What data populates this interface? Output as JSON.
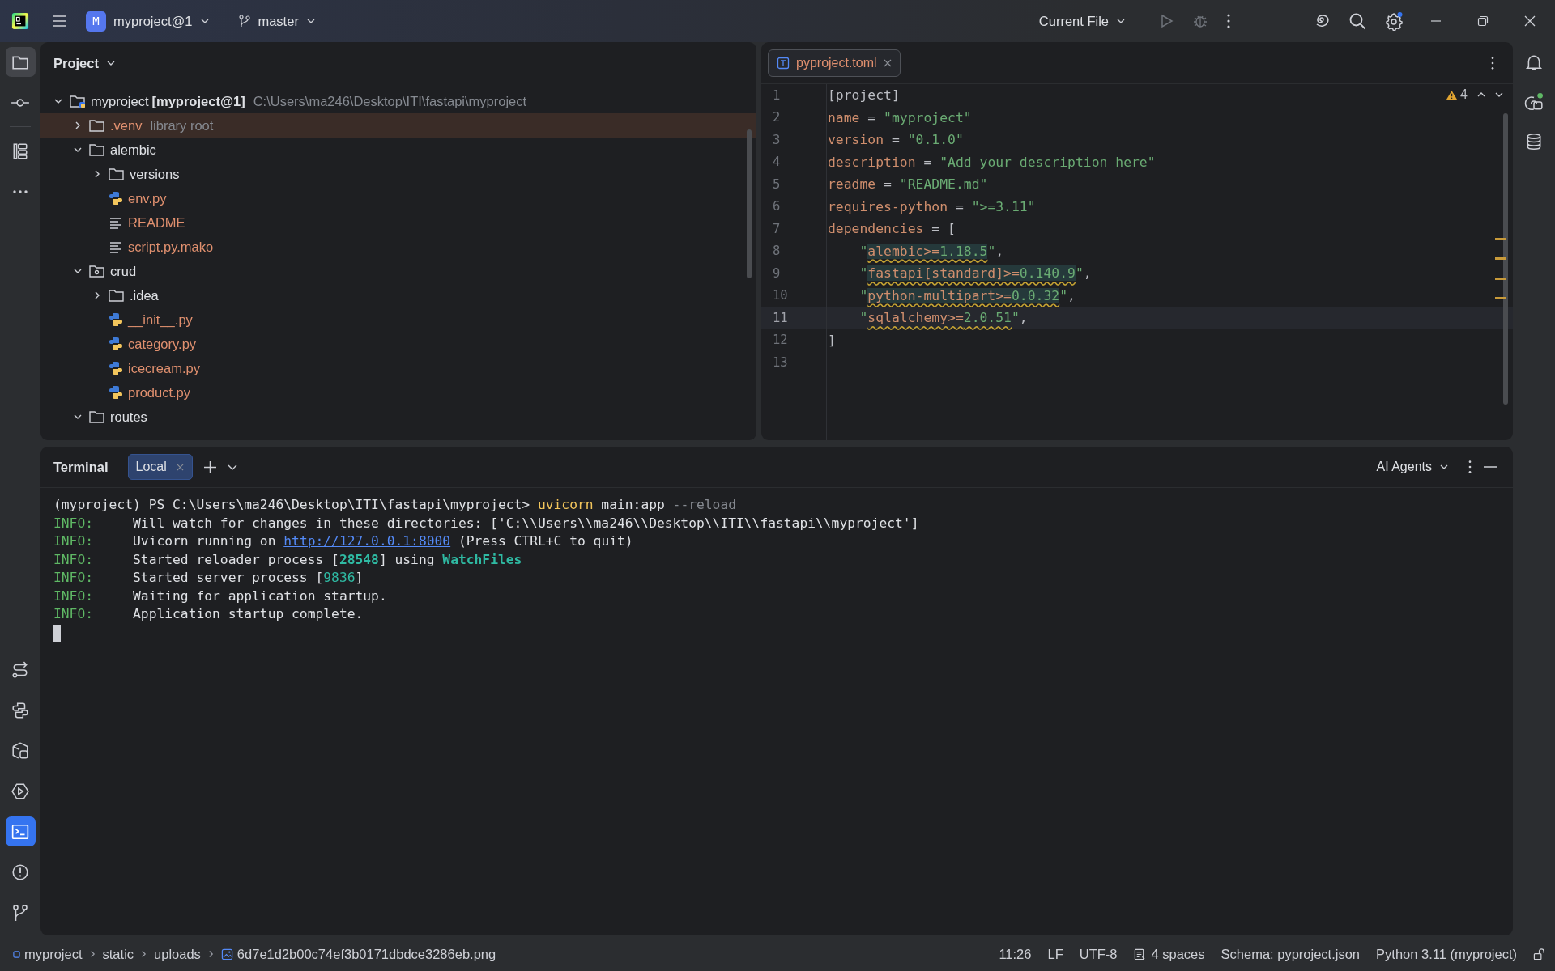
{
  "top_bar": {
    "project": {
      "badge": "M",
      "name": "myproject@1"
    },
    "branch": "master",
    "run_config": "Current File"
  },
  "left_toolbar": {
    "top": [
      {
        "selected": true
      },
      {
        "selected": false
      },
      {
        "selected": false
      },
      {
        "selected": false
      }
    ],
    "bottom": [
      {
        "selected": false
      },
      {
        "selected": false
      },
      {
        "selected": false
      },
      {
        "selected": false
      },
      {
        "selected": true
      },
      {
        "selected": false
      },
      {
        "selected": false
      }
    ]
  },
  "project_panel": {
    "title": "Project",
    "tree": [
      {
        "name": "myproject",
        "module": "[myproject@1]",
        "path": "C:\\Users\\ma246\\Desktop\\ITI\\fastapi\\myproject",
        "kind": "root",
        "expanded": true,
        "selected": false,
        "untracked": false,
        "children": [
          {
            "name": ".venv",
            "note": "library root",
            "kind": "folder",
            "expanded": false,
            "selected": true,
            "untracked": true
          },
          {
            "name": "alembic",
            "kind": "folder",
            "expanded": true,
            "selected": false,
            "untracked": false,
            "children": [
              {
                "name": "versions",
                "kind": "folder",
                "expanded": false,
                "selected": false,
                "untracked": false
              },
              {
                "name": "env.py",
                "kind": "python",
                "selected": false,
                "untracked": true
              },
              {
                "name": "README",
                "kind": "text",
                "selected": false,
                "untracked": true
              },
              {
                "name": "script.py.mako",
                "kind": "text",
                "selected": false,
                "untracked": true
              }
            ]
          },
          {
            "name": "crud",
            "kind": "package",
            "expanded": true,
            "selected": false,
            "untracked": false,
            "children": [
              {
                "name": ".idea",
                "kind": "folder",
                "expanded": false,
                "selected": false,
                "untracked": false
              },
              {
                "name": "__init__.py",
                "kind": "python",
                "selected": false,
                "untracked": true
              },
              {
                "name": "category.py",
                "kind": "python",
                "selected": false,
                "untracked": true
              },
              {
                "name": "icecream.py",
                "kind": "python",
                "selected": false,
                "untracked": true
              },
              {
                "name": "product.py",
                "kind": "python",
                "selected": false,
                "untracked": true
              }
            ]
          },
          {
            "name": "routes",
            "kind": "folder",
            "expanded": true,
            "selected": false,
            "untracked": false
          }
        ]
      }
    ]
  },
  "editor": {
    "tabs": [
      {
        "label": "pyproject.toml",
        "selected": true
      }
    ],
    "warnings": "4",
    "lines": [
      {
        "number": "1",
        "current": false,
        "segments": [
          {
            "text": "[project]",
            "kind": "punct"
          }
        ]
      },
      {
        "number": "2",
        "current": false,
        "segments": [
          {
            "text": "name",
            "kind": "key"
          },
          {
            "text": " = ",
            "kind": "punct"
          },
          {
            "text": "\"myproject\"",
            "kind": "str"
          }
        ]
      },
      {
        "number": "3",
        "current": false,
        "segments": [
          {
            "text": "version",
            "kind": "key"
          },
          {
            "text": " = ",
            "kind": "punct"
          },
          {
            "text": "\"0.1.0\"",
            "kind": "str"
          }
        ]
      },
      {
        "number": "4",
        "current": false,
        "segments": [
          {
            "text": "description",
            "kind": "key"
          },
          {
            "text": " = ",
            "kind": "punct"
          },
          {
            "text": "\"Add your description here\"",
            "kind": "str"
          }
        ]
      },
      {
        "number": "5",
        "current": false,
        "segments": [
          {
            "text": "readme",
            "kind": "key"
          },
          {
            "text": " = ",
            "kind": "punct"
          },
          {
            "text": "\"README.md\"",
            "kind": "str"
          }
        ]
      },
      {
        "number": "6",
        "current": false,
        "segments": [
          {
            "text": "requires-python",
            "kind": "key"
          },
          {
            "text": " = ",
            "kind": "punct"
          },
          {
            "text": "\">=3.11\"",
            "kind": "str"
          }
        ]
      },
      {
        "number": "7",
        "current": false,
        "segments": [
          {
            "text": "dependencies",
            "kind": "key"
          },
          {
            "text": " = [",
            "kind": "punct"
          }
        ]
      },
      {
        "number": "8",
        "current": false,
        "highlighted": true,
        "segments": [
          {
            "text": "    \"",
            "kind": "str"
          },
          {
            "text": "alembic>=",
            "kind": "package"
          },
          {
            "text": "1.18.5",
            "kind": "version"
          },
          {
            "text": "\"",
            "kind": "str"
          },
          {
            "text": ",",
            "kind": "punct"
          }
        ]
      },
      {
        "number": "9",
        "current": false,
        "highlighted": true,
        "segments": [
          {
            "text": "    \"",
            "kind": "str"
          },
          {
            "text": "fastapi[standard]>=",
            "kind": "package"
          },
          {
            "text": "0.140.9",
            "kind": "version"
          },
          {
            "text": "\"",
            "kind": "str"
          },
          {
            "text": ",",
            "kind": "punct"
          }
        ]
      },
      {
        "number": "10",
        "current": false,
        "highlighted": true,
        "segments": [
          {
            "text": "    \"",
            "kind": "str"
          },
          {
            "text": "python-multipart>=",
            "kind": "package"
          },
          {
            "text": "0.0.32",
            "kind": "version"
          },
          {
            "text": "\"",
            "kind": "str"
          },
          {
            "text": ",",
            "kind": "punct"
          }
        ]
      },
      {
        "number": "11",
        "current": true,
        "highlighted": false,
        "segments": [
          {
            "text": "    \"",
            "kind": "str"
          },
          {
            "text": "sqlalchemy>=",
            "kind": "package"
          },
          {
            "text": "2.0.51",
            "kind": "version"
          },
          {
            "text": "\"",
            "kind": "str"
          },
          {
            "text": ",",
            "kind": "punct"
          }
        ]
      },
      {
        "number": "12",
        "current": false,
        "segments": [
          {
            "text": "]",
            "kind": "punct"
          }
        ]
      },
      {
        "number": "13",
        "current": false
      }
    ]
  },
  "terminal": {
    "title": "Terminal",
    "tabs": [
      {
        "label": "Local",
        "selected": true
      }
    ],
    "agents": "AI Agents",
    "lines": [
      {
        "segments": [
          {
            "text": "(myproject) PS C:\\Users\\ma246\\Desktop\\ITI\\fastapi\\myproject> ",
            "kind": "plain"
          },
          {
            "text": "uvicorn",
            "kind": "command"
          },
          {
            "text": " main:app ",
            "kind": "plain"
          },
          {
            "text": "--reload",
            "kind": "option"
          }
        ]
      },
      {
        "segments": [
          {
            "text": "INFO:",
            "kind": "level"
          },
          {
            "text": "     Will watch for changes in these directories: ['C:\\\\Users\\\\ma246\\\\Desktop\\\\ITI\\\\fastapi\\\\myproject']",
            "kind": "plain"
          }
        ]
      },
      {
        "segments": [
          {
            "text": "INFO:",
            "kind": "level"
          },
          {
            "text": "     Uvicorn running on ",
            "kind": "plain"
          },
          {
            "text": "http://127.0.0.1:8000",
            "kind": "link"
          },
          {
            "text": " (Press CTRL+C to quit)",
            "kind": "plain"
          }
        ]
      },
      {
        "segments": [
          {
            "text": "INFO:",
            "kind": "level"
          },
          {
            "text": "     Started reloader process [",
            "kind": "plain"
          },
          {
            "text": "28548",
            "kind": "emphasis"
          },
          {
            "text": "] using ",
            "kind": "plain"
          },
          {
            "text": "WatchFiles",
            "kind": "emphasis"
          }
        ]
      },
      {
        "segments": [
          {
            "text": "INFO:",
            "kind": "level"
          },
          {
            "text": "     Started server process [",
            "kind": "plain"
          },
          {
            "text": "9836",
            "kind": "number"
          },
          {
            "text": "]",
            "kind": "plain"
          }
        ]
      },
      {
        "segments": [
          {
            "text": "INFO:",
            "kind": "level"
          },
          {
            "text": "     Waiting for application startup.",
            "kind": "plain"
          }
        ]
      },
      {
        "segments": [
          {
            "text": "INFO:",
            "kind": "level"
          },
          {
            "text": "     Application startup complete.",
            "kind": "plain"
          }
        ]
      }
    ]
  },
  "status_bar": {
    "breadcrumbs": [
      {
        "label": "myproject",
        "kind": "module"
      },
      {
        "label": "static",
        "kind": "folder"
      },
      {
        "label": "uploads",
        "kind": "folder"
      },
      {
        "label": "6d7e1d2b00c74ef3b0171dbdce3286eb.png",
        "kind": "image"
      }
    ],
    "items": [
      {
        "label": "11:26",
        "kind": "text"
      },
      {
        "label": "LF",
        "kind": "text"
      },
      {
        "label": "UTF-8",
        "kind": "text"
      },
      {
        "label": "4 spaces",
        "kind": "indent"
      },
      {
        "label": "Schema: pyproject.json",
        "kind": "text"
      },
      {
        "label": "Python 3.11 (myproject)",
        "kind": "text"
      }
    ]
  }
}
